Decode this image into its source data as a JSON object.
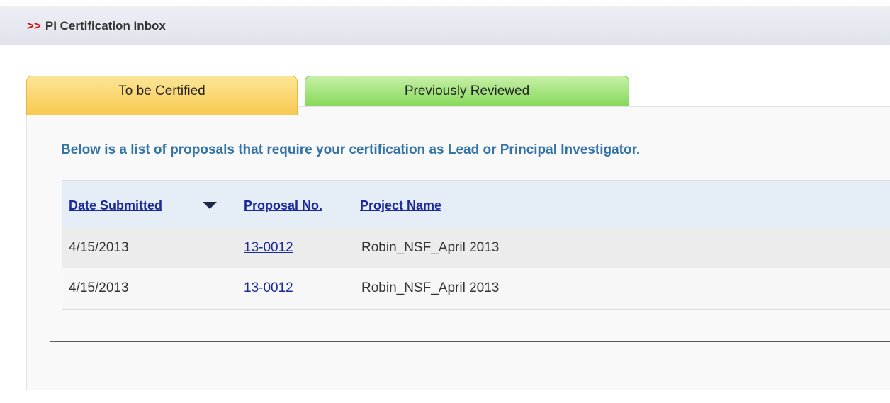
{
  "header": {
    "prefix": ">>",
    "title": "PI Certification Inbox"
  },
  "tabs": [
    {
      "label": "To be Certified",
      "active": true,
      "color": "#f7c94e"
    },
    {
      "label": "Previously Reviewed",
      "active": false,
      "color": "#86d85a"
    }
  ],
  "intro": "Below is a list of proposals that require your certification as Lead or Principal Investigator.",
  "table": {
    "columns": [
      "Date Submitted",
      "Proposal No.",
      "Project Name"
    ],
    "sort_indicator": "descending",
    "rows": [
      {
        "date": "4/15/2013",
        "proposal": "13-0012",
        "project": "Robin_NSF_April 2013"
      },
      {
        "date": "4/15/2013",
        "proposal": "13-0012",
        "project": "Robin_NSF_April 2013"
      }
    ]
  },
  "colors": {
    "accent_chevron": "#cc1010",
    "intro_text": "#3373a8",
    "link": "#1a2a9c"
  }
}
